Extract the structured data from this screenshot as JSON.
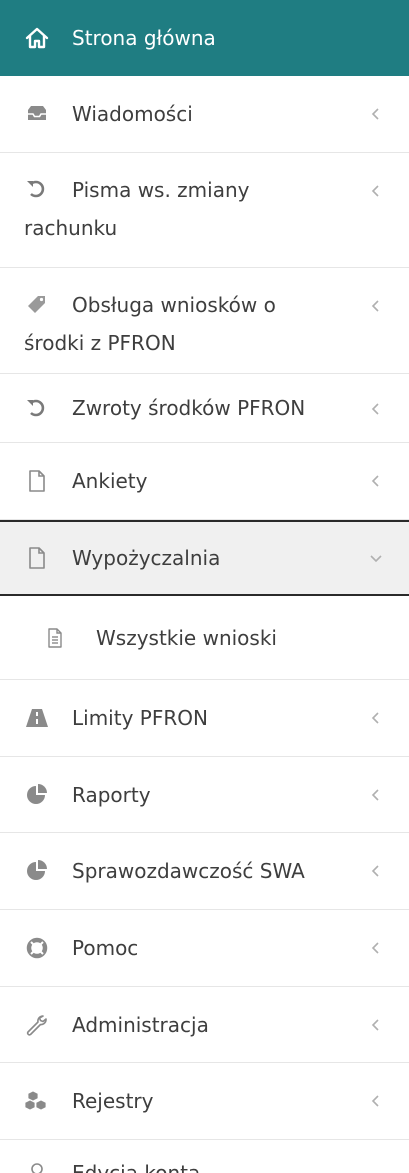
{
  "sidebar": {
    "home": {
      "label": "Strona główna",
      "icon": "home-icon"
    },
    "items": [
      {
        "label": "Wiadomości",
        "icon": "inbox-icon"
      },
      {
        "label_line1": "Pisma ws. zmiany",
        "label_line2": "rachunku",
        "icon": "undo-icon"
      },
      {
        "label_line1": "Obsługa wniosków o",
        "label_line2": "środki z PFRON",
        "icon": "tag-icon"
      },
      {
        "label": "Zwroty środków PFRON",
        "icon": "undo-icon"
      },
      {
        "label": "Ankiety",
        "icon": "document-icon"
      },
      {
        "label": "Wypożyczalnia",
        "icon": "document-icon",
        "expanded": true
      },
      {
        "label": "Wszystkie wnioski",
        "icon": "file-text-icon",
        "sub": true
      },
      {
        "label": "Limity PFRON",
        "icon": "road-icon"
      },
      {
        "label": "Raporty",
        "icon": "pie-chart-icon"
      },
      {
        "label": "Sprawozdawczość SWA",
        "icon": "pie-chart-icon"
      },
      {
        "label": "Pomoc",
        "icon": "lifebuoy-icon"
      },
      {
        "label": "Administracja",
        "icon": "wrench-icon"
      },
      {
        "label": "Rejestry",
        "icon": "cubes-icon"
      },
      {
        "label": "Edycja konta",
        "icon": "user-icon"
      }
    ]
  },
  "colors": {
    "home_bg": "#1f7d82",
    "text": "#3e3e3e",
    "icon": "#8a8a8a",
    "chevron": "#b0b0b0",
    "active_bg": "#f0f0f0"
  }
}
